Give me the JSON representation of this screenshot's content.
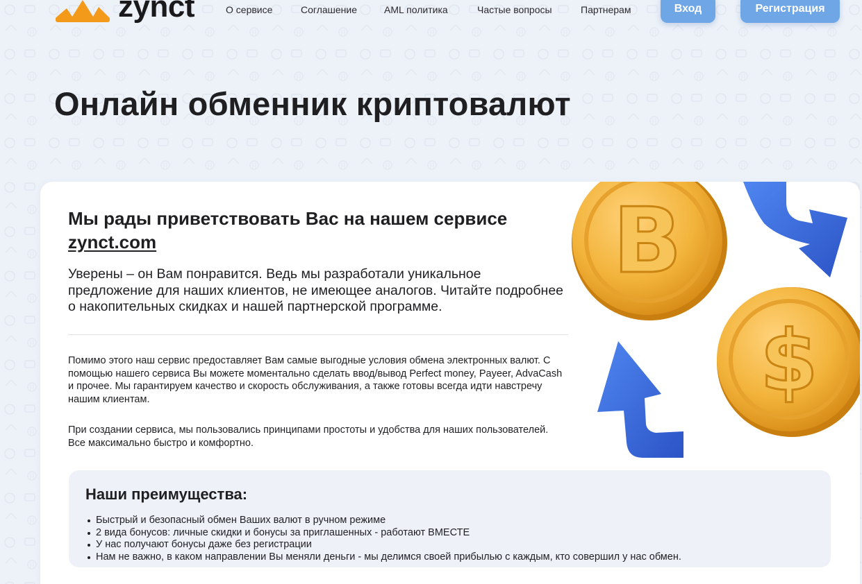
{
  "header": {
    "logo_text": "zynct",
    "nav": [
      "О сервисе",
      "Соглашение",
      "AML политика",
      "Частые вопросы",
      "Партнерам"
    ],
    "login_label": "Вход",
    "register_label": "Регистрация"
  },
  "main": {
    "title": "Онлайн обменник криптовалют",
    "welcome_prefix": "Мы рады приветствовать Вас на нашем сервисе",
    "welcome_link": "zynct.com",
    "lead": "Уверены – он Вам понравится. Ведь мы разработали уникальное предложение для наших клиентов, не имеющее аналогов. Читайте подробнее о накопительных скидках и нашей партнерской программе.",
    "paragraph_1": "Помимо этого наш сервис предоставляет Вам самые выгодные условия обмена электронных валют. С помощью нашего сервиса Вы можете моментально сделать ввод/вывод Perfect money, Payeer, AdvaCash и прочее. Мы гарантируем качество и скорость обслуживания, а также готовы всегда идти навстречу нашим клиентам.",
    "paragraph_2": "При создании сервиса, мы пользовались принципами простоты и удобства для наших пользователей. Все максимально быстро и комфортно."
  },
  "advantages": {
    "title": "Наши преимущества:",
    "items": [
      "Быстрый и безопасный обмен Ваших валют в ручном режиме",
      "2 вида бонусов: личные скидки и бонусы за приглашенных - работают ВМЕСТЕ",
      "У нас получают бонусы даже без регистрации",
      "Нам не важно, в каком направлении Вы меняли деньги - мы делимся своей прибылью с каждым, кто совершил у нас обмен."
    ]
  },
  "illustration": {
    "icons": [
      "bitcoin-coin-icon",
      "dollar-coin-icon",
      "arrow-down-icon",
      "arrow-up-icon"
    ]
  },
  "colors": {
    "accent": "#6fa7e6",
    "logo": "#f39a1b",
    "text": "#1f1f22",
    "coin": "#f2b33a",
    "arrow": "#3566d6"
  }
}
